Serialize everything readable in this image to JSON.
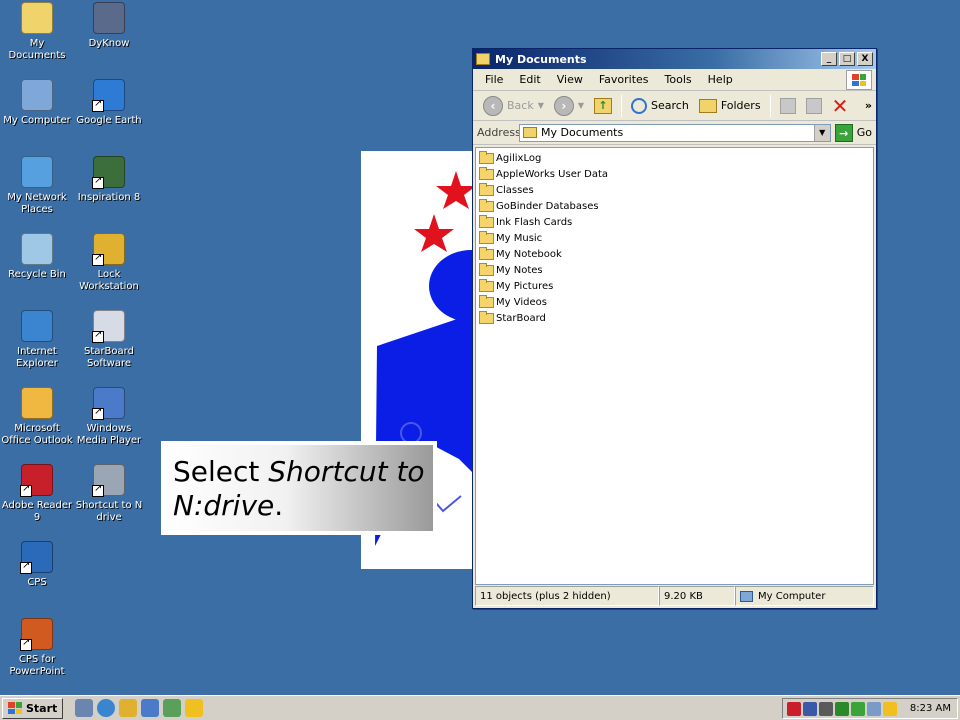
{
  "desktop": {
    "icons": [
      {
        "label": "My Documents",
        "icon": "my-documents-icon",
        "color": "#f0d36a"
      },
      {
        "label": "DyKnow",
        "icon": "dyknow-icon",
        "color": "#5a6a8a"
      },
      {
        "label": "My Computer",
        "icon": "my-computer-icon",
        "color": "#7fa8d8"
      },
      {
        "label": "Google Earth",
        "icon": "google-earth-icon",
        "color": "#2e7bd6"
      },
      {
        "label": "My Network Places",
        "icon": "network-places-icon",
        "color": "#56a0e0"
      },
      {
        "label": "Inspiration 8",
        "icon": "inspiration-icon",
        "color": "#3c6e3c"
      },
      {
        "label": "Recycle Bin",
        "icon": "recycle-bin-icon",
        "color": "#9fc8e6"
      },
      {
        "label": "Lock Workstation",
        "icon": "lock-icon",
        "color": "#e0b030"
      },
      {
        "label": "Internet Explorer",
        "icon": "internet-explorer-icon",
        "color": "#3a84d0"
      },
      {
        "label": "StarBoard Software",
        "icon": "starboard-icon",
        "color": "#d6dbe6"
      },
      {
        "label": "Microsoft Office Outlook",
        "icon": "outlook-icon",
        "color": "#f0b840"
      },
      {
        "label": "Windows Media Player",
        "icon": "media-player-icon",
        "color": "#4a7ac8"
      },
      {
        "label": "Adobe Reader 9",
        "icon": "adobe-reader-icon",
        "color": "#c8202a"
      },
      {
        "label": "Shortcut to N drive",
        "icon": "network-drive-icon",
        "color": "#9aa6b4"
      },
      {
        "label": "CPS",
        "icon": "cps-icon",
        "color": "#2a6ab8"
      },
      {
        "label": "CPS for PowerPoint",
        "icon": "cps-powerpoint-icon",
        "color": "#d05a20"
      }
    ]
  },
  "callout": {
    "text_prefix": "Select ",
    "text_emph": "Shortcut to N:drive",
    "text_suffix": "."
  },
  "window": {
    "title": "My Documents",
    "controls": {
      "minimize": "_",
      "maximize": "□",
      "close": "X"
    },
    "menu": [
      "File",
      "Edit",
      "View",
      "Favorites",
      "Tools",
      "Help"
    ],
    "toolbar": {
      "back": "Back",
      "search": "Search",
      "folders": "Folders",
      "more": "»"
    },
    "address": {
      "label": "Address",
      "value": "My Documents",
      "go": "Go"
    },
    "files": [
      "AgilixLog",
      "AppleWorks User Data",
      "Classes",
      "GoBinder Databases",
      "Ink Flash Cards",
      "My Music",
      "My Notebook",
      "My Notes",
      "My Pictures",
      "My Videos",
      "StarBoard"
    ],
    "status": {
      "objects": "11 objects (plus 2 hidden)",
      "size": "9.20 KB",
      "location": "My Computer"
    }
  },
  "taskbar": {
    "start": "Start",
    "clock": "8:23 AM"
  },
  "colors": {
    "desktop": "#3a6ea5",
    "titlebar": "#0a246a",
    "poster_red": "#e0121e",
    "poster_blue": "#0a1ee6"
  }
}
